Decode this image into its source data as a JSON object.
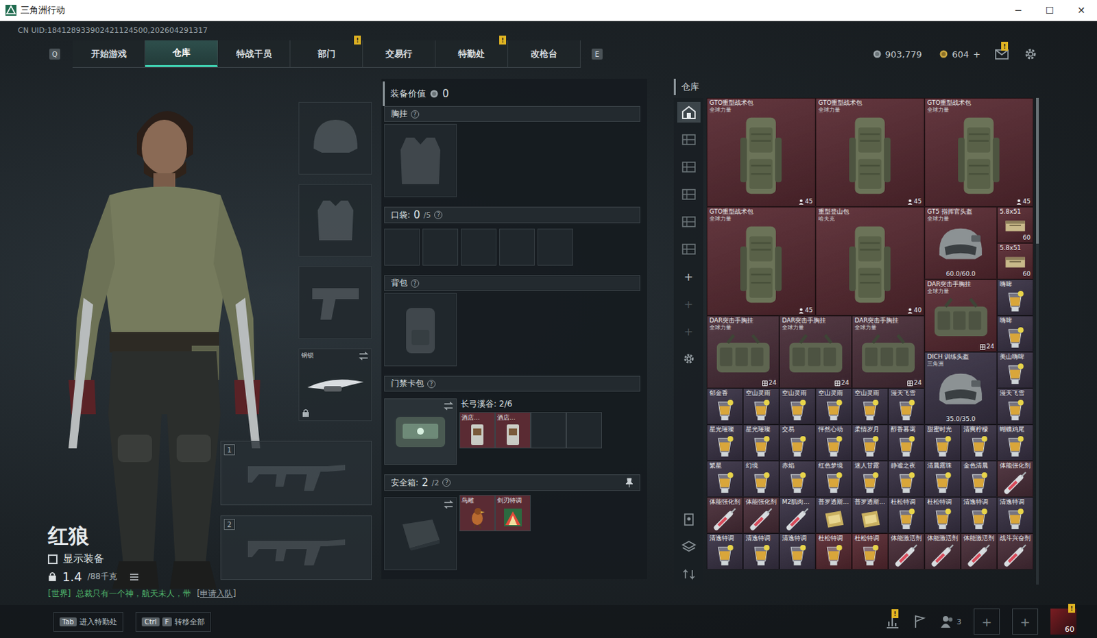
{
  "window": {
    "title": "三角洲行动",
    "controls": [
      "─",
      "☐",
      "✕"
    ]
  },
  "uid": "CN UID:184128933902421124500,202604291317",
  "nav": {
    "left_key": "Q",
    "right_key": "E",
    "tabs": [
      {
        "label": "开始游戏",
        "selected": false
      },
      {
        "label": "仓库",
        "selected": true
      },
      {
        "label": "特战干员",
        "selected": false
      },
      {
        "label": "部门",
        "selected": false,
        "badge": "!"
      },
      {
        "label": "交易行",
        "selected": false
      },
      {
        "label": "特勤处",
        "selected": false,
        "badge": "!"
      },
      {
        "label": "改枪台",
        "selected": false
      }
    ]
  },
  "currency": {
    "coins": "903,779",
    "tokens": "604",
    "add": "+",
    "mail_badge": "!"
  },
  "operator": {
    "name": "红狼",
    "show_gear": {
      "label": "显示装备",
      "checked": false
    },
    "weight": "1.4",
    "weight_max": "/88千克"
  },
  "chat": {
    "channel": "[世界]",
    "text": "总裁只有一个神，航天未人，带",
    "action": "[申请入队]"
  },
  "equipment": {
    "slots": [
      {
        "kind": "helmet"
      },
      {
        "kind": "armor"
      },
      {
        "kind": "pistol"
      },
      {
        "kind": "melee",
        "label": "钢锁",
        "locked": true
      }
    ],
    "weapons": [
      {
        "number": "1"
      },
      {
        "number": "2"
      }
    ]
  },
  "loadout": {
    "value_label": "装备价值",
    "value": "0",
    "chest": {
      "label": "胸挂",
      "help": "?"
    },
    "pockets": {
      "label": "口袋:",
      "used": "0",
      "cap": "/5",
      "help": "?",
      "slot_count": 5
    },
    "backpack": {
      "label": "背包",
      "help": "?"
    },
    "keycard": {
      "label": "门禁卡包",
      "help": "?",
      "map": "长弓溪谷: 2/6",
      "cards": [
        {
          "name": "酒店..."
        },
        {
          "name": "酒店..."
        }
      ],
      "slot_count": 4
    },
    "safebox": {
      "label": "安全箱:",
      "used": "2",
      "cap": "/2",
      "help": "?",
      "items": [
        {
          "name": "鸟雕"
        },
        {
          "name": "剑刃特调"
        }
      ]
    }
  },
  "warehouse": {
    "title": "仓库",
    "scroll_level": 0.3,
    "side_tabs": [
      {
        "selected": true
      },
      {
        "selected": false
      },
      {
        "selected": false
      },
      {
        "selected": false
      },
      {
        "selected": false
      },
      {
        "selected": false
      }
    ],
    "add_tabs": [
      {
        "label": "+",
        "disabled": false
      },
      {
        "label": "+",
        "disabled": true
      },
      {
        "label": "+",
        "disabled": true
      }
    ],
    "items": [
      {
        "name": "GTO重型战术包",
        "sub": "全球力量",
        "count": "45",
        "color": "#5a2b33",
        "kind": "bag"
      },
      {
        "name": "GTO重型战术包",
        "sub": "全球力量",
        "count": "45",
        "color": "#5a2b33",
        "kind": "bag"
      },
      {
        "name": "GTO重型战术包",
        "sub": "全球力量",
        "count": "45",
        "color": "#5a2b33",
        "kind": "bag"
      },
      {
        "name": "GTO重型战术包",
        "sub": "全球力量",
        "count": "45",
        "color": "#5a2b33",
        "kind": "bag"
      },
      {
        "name": "重型登山包",
        "sub": "哈夫克",
        "count": "40",
        "color": "#5a2b33",
        "kind": "bag"
      },
      {
        "name": "GT5 指挥官头盔",
        "sub": "全球力量",
        "durability": "60.0/60.0",
        "color": "#5a2b33",
        "kind": "helmet"
      },
      {
        "name": "5.8x51",
        "count": "60",
        "color": "#5a2b33",
        "kind": "ammo"
      },
      {
        "name": "5.8x51",
        "count": "60",
        "color": "#5a2b33",
        "kind": "ammo"
      },
      {
        "name": "DAR突击手胸挂",
        "sub": "全球力量",
        "count": "24",
        "color": "#5a2b33",
        "kind": "vest"
      },
      {
        "name": "嗨啤",
        "color": "#3b3447",
        "kind": "drink"
      },
      {
        "name": "DAR突击手胸挂",
        "sub": "全球力量",
        "count": "24",
        "color": "#4b2f3a",
        "kind": "vest"
      },
      {
        "name": "DAR突击手胸挂",
        "sub": "全球力量",
        "count": "24",
        "color": "#4b2f3a",
        "kind": "vest"
      },
      {
        "name": "DAR突击手胸挂",
        "sub": "全球力量",
        "count": "24",
        "color": "#4b2f3a",
        "kind": "vest"
      },
      {
        "name": "嗨啤",
        "color": "#3b3447",
        "kind": "drink"
      },
      {
        "name": "DICH 训练头盔",
        "sub": "三角洲",
        "durability": "35.0/35.0",
        "color": "#3b3447",
        "kind": "helmet"
      },
      {
        "name": "美山嗨啤",
        "color": "#3b3447",
        "kind": "drink"
      },
      {
        "name": "郁金香",
        "color": "#3b3447",
        "kind": "drink"
      },
      {
        "name": "空山灵雨",
        "color": "#3b3447",
        "kind": "drink"
      },
      {
        "name": "空山灵雨",
        "color": "#3b3447",
        "kind": "drink"
      },
      {
        "name": "空山灵雨",
        "color": "#3b3447",
        "kind": "drink"
      },
      {
        "name": "空山灵雨",
        "color": "#3b3447",
        "kind": "drink"
      },
      {
        "name": "漫天飞雪",
        "color": "#3b3447",
        "kind": "drink"
      },
      {
        "name": "漫天飞雪",
        "color": "#3b3447",
        "kind": "drink"
      },
      {
        "name": "星光璀璨",
        "color": "#3b3447",
        "kind": "drink"
      },
      {
        "name": "星光璀璨",
        "color": "#3b3447",
        "kind": "drink"
      },
      {
        "name": "交易",
        "color": "#3b3447",
        "kind": "drink"
      },
      {
        "name": "怦然心动",
        "color": "#3b3447",
        "kind": "drink"
      },
      {
        "name": "柔情岁月",
        "color": "#3b3447",
        "kind": "drink"
      },
      {
        "name": "醇香暮霭",
        "color": "#3b3447",
        "kind": "drink"
      },
      {
        "name": "甜蜜时光",
        "color": "#3b3447",
        "kind": "drink"
      },
      {
        "name": "清爽柠檬",
        "color": "#3b3447",
        "kind": "drink"
      },
      {
        "name": "蝴蝶鸡尾",
        "color": "#3b3447",
        "kind": "drink"
      },
      {
        "name": "繁星",
        "color": "#3b3447",
        "kind": "drink"
      },
      {
        "name": "幻境",
        "color": "#3b3447",
        "kind": "drink"
      },
      {
        "name": "赤焰",
        "color": "#3b3447",
        "kind": "drink"
      },
      {
        "name": "红色梦境",
        "color": "#3b3447",
        "kind": "drink"
      },
      {
        "name": "迷人甘露",
        "color": "#3b3447",
        "kind": "drink"
      },
      {
        "name": "静谧之夜",
        "color": "#3b3447",
        "kind": "drink"
      },
      {
        "name": "清晨露珠",
        "color": "#3b3447",
        "kind": "drink"
      },
      {
        "name": "金色清晨",
        "color": "#3b3447",
        "kind": "drink"
      },
      {
        "name": "体能强化剂",
        "color": "#4b2f3a",
        "kind": "syringe"
      },
      {
        "name": "体能强化剂",
        "color": "#4b2f3a",
        "kind": "syringe"
      },
      {
        "name": "体能强化剂",
        "color": "#4b2f3a",
        "kind": "syringe"
      },
      {
        "name": "M2肌肉...",
        "color": "#3b3447",
        "kind": "syringe"
      },
      {
        "name": "普罗透斯...",
        "color": "#3b3447",
        "kind": "box"
      },
      {
        "name": "普罗透斯...",
        "color": "#3b3447",
        "kind": "box"
      },
      {
        "name": "杜松特调",
        "color": "#3b3447",
        "kind": "drink"
      },
      {
        "name": "杜松特调",
        "color": "#3b3447",
        "kind": "drink"
      },
      {
        "name": "清逸特调",
        "color": "#3b3447",
        "kind": "drink"
      },
      {
        "name": "清逸特调",
        "color": "#3b3447",
        "kind": "drink"
      },
      {
        "name": "清逸特调",
        "color": "#3b3447",
        "kind": "drink"
      },
      {
        "name": "清逸特调",
        "color": "#3b3447",
        "kind": "drink"
      },
      {
        "name": "清逸特调",
        "color": "#3b3447",
        "kind": "drink"
      },
      {
        "name": "杜松特调",
        "color": "#5a2b33",
        "kind": "drink"
      },
      {
        "name": "杜松特调",
        "color": "#5a2b33",
        "kind": "drink"
      },
      {
        "name": "体能激活剂",
        "color": "#4b2f3a",
        "kind": "syringe"
      },
      {
        "name": "体能激活剂",
        "color": "#4b2f3a",
        "kind": "syringe"
      },
      {
        "name": "体能激活剂",
        "color": "#4b2f3a",
        "kind": "syringe"
      },
      {
        "name": "战斗兴奋剂",
        "color": "#4b2f3a",
        "kind": "syringe"
      }
    ]
  },
  "bottom": {
    "hints": [
      {
        "keys": [
          "Tab"
        ],
        "label": "进入特勤处"
      },
      {
        "keys": [
          "Ctrl",
          "F"
        ],
        "label": "转移全部"
      }
    ],
    "stats_badge": "!",
    "team_count": "3",
    "invite_slots": [
      "+",
      "+"
    ],
    "avatar_level": "60",
    "avatar_badge": "!"
  }
}
